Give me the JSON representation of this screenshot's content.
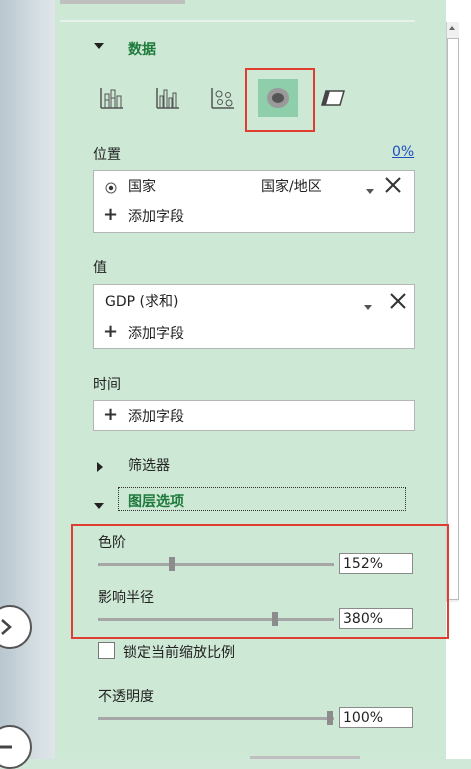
{
  "data_section": {
    "title": "数据"
  },
  "location": {
    "label": "位置",
    "percent": "0%",
    "field_name": "国家",
    "field_type": "国家/地区",
    "add_field": "添加字段"
  },
  "value": {
    "label": "值",
    "field_name": "GDP (求和)",
    "add_field": "添加字段"
  },
  "time": {
    "label": "时间",
    "add_field": "添加字段"
  },
  "filter": {
    "title": "筛选器"
  },
  "layer_options": {
    "title": "图层选项",
    "color_scale": {
      "label": "色阶",
      "value": "152%",
      "level": 0.3
    },
    "influence_radius": {
      "label": "影响半径",
      "value": "380%",
      "level": 0.76
    },
    "lock_zoom_label": "锁定当前缩放比例",
    "opacity": {
      "label": "不透明度",
      "value": "100%",
      "level": 1.0
    }
  },
  "colors": {
    "accent": "#1e7a3c",
    "highlight_frame": "#e03c31",
    "panel_bg": "#cde8d4"
  }
}
